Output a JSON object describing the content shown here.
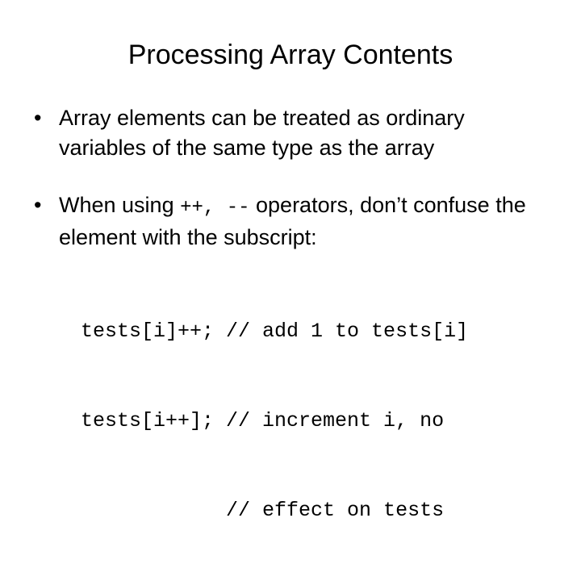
{
  "slide": {
    "title": "Processing Array Contents",
    "background_color": "#ffffff",
    "text_color": "#000000",
    "bullet_marker": "•",
    "bullets": [
      {
        "id": "bullet-array-elements",
        "segments": {
          "part1": "Array elements can be treated as ordinary variables of the same type as the array"
        },
        "full_text": "Array elements can be treated as ordinary variables of the same type as the array"
      },
      {
        "id": "bullet-increment-operators",
        "segments": {
          "lead": "When using ",
          "operators": "++, --",
          "tail": " operators, don’t confuse the element with the subscript:"
        },
        "full_text": "When using ++, -- operators, don’t confuse the element with the subscript:"
      }
    ],
    "code_lines": [
      "tests[i]++; // add 1 to tests[i]",
      "tests[i++]; // increment i, no",
      "            // effect on tests"
    ]
  }
}
